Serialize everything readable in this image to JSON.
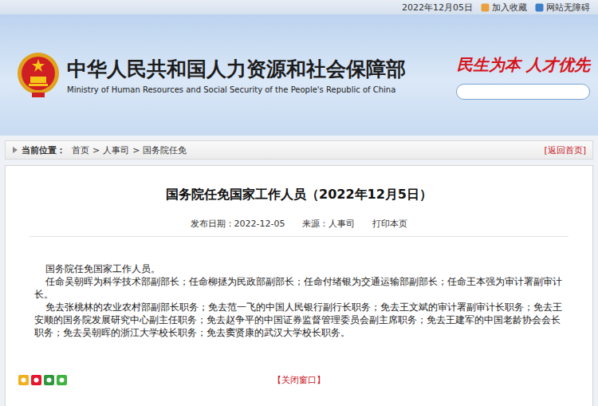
{
  "top_bar": {
    "date": "2022年12月05日",
    "links": [
      "加入收藏",
      "网站无障碍"
    ]
  },
  "header": {
    "title_cn": "中华人民共和国人力资源和社会保障部",
    "title_en": "Ministry of Human Resources and Social Security of the People's Republic of China",
    "slogan": "民生为本 人才优先"
  },
  "breadcrumb": {
    "label": "当前位置：",
    "items": [
      "首页",
      "人事司",
      "国务院任免"
    ],
    "separator": ">",
    "back_link": "[返回首页]"
  },
  "article": {
    "title": "国务院任免国家工作人员（2022年12月5日）",
    "meta": [
      {
        "label": "发布日期：",
        "value": "2022-12-05"
      },
      {
        "label": "来源：",
        "value": "人事司"
      }
    ],
    "print": "打印本页",
    "paragraphs": [
      "国务院任免国家工作人员。",
      "任命吴朝晖为科学技术部副部长；任命柳拯为民政部副部长；任命付绪银为交通运输部副部长；任命王本强为审计署副审计长。",
      "免去张桃林的农业农村部副部长职务；免去范一飞的中国人民银行副行长职务；免去王文斌的审计署副审计长职务；免去王安顺的国务院发展研究中心副主任职务；免去赵争平的中国证券监督管理委员会副主席职务；免去王建军的中国老龄协会会长职务；免去吴朝晖的浙江大学校长职务；免去窦贤康的武汉大学校长职务。"
    ],
    "close": "【关闭窗口】"
  }
}
